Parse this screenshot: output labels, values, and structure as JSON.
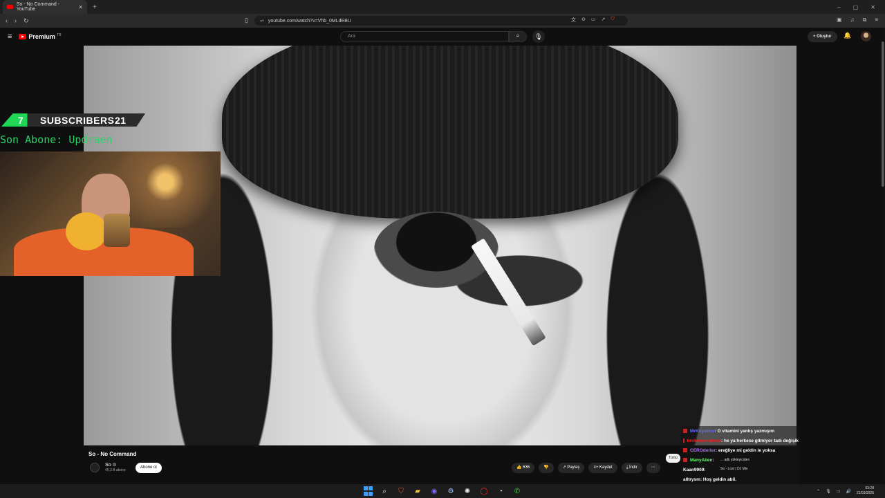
{
  "browser": {
    "tab_title": "So - No Command - YouTube",
    "new_tab": "+",
    "url": "youtube.com/watch?v=Vhb_0MLdEBU"
  },
  "youtube": {
    "logo_label": "Premium",
    "logo_region": "TR",
    "search_placeholder": "Ara",
    "create_label": "+ Oluştur"
  },
  "overlay": {
    "subs_current": "7",
    "subs_label": "SUBSCRIBERS",
    "subs_goal": "21",
    "last_sub": "Son Abone: Updraen"
  },
  "video": {
    "title": "So - No Command",
    "channel_name": "So ⊙",
    "channel_subs": "45,3 B abone",
    "subscribe_label": "Abone ol",
    "likes": "👍 636",
    "dislike": "👎",
    "share_label": "↗ Paylaş",
    "save_label": "≡+ Kaydet",
    "download_label": "⤓ İndir",
    "more_label": "⋯"
  },
  "chat": {
    "messages": [
      {
        "user": "MrKoyuncu",
        "text": ": D vitamini yanlış yazmışım"
      },
      {
        "user": "brokennerpross",
        "text": ": he ya herkese gitmiyor tadı değişik"
      },
      {
        "user": "CEROderler",
        "text": ": ereğliye mi geldin le yoksa"
      },
      {
        "user": "ManyAlien",
        "text": ":"
      },
      {
        "user": "Kaan9909",
        "text": ":"
      },
      {
        "user": "aIltrysm",
        "text": ": Hoş geldin abil."
      }
    ],
    "filter_label": "Tümü",
    "mix_title": "So - Lost | DJ Mix",
    "mix_sub": "... adlı yükleyiciden"
  },
  "tray": {
    "time": "03:28",
    "date": "21/03/2026"
  }
}
